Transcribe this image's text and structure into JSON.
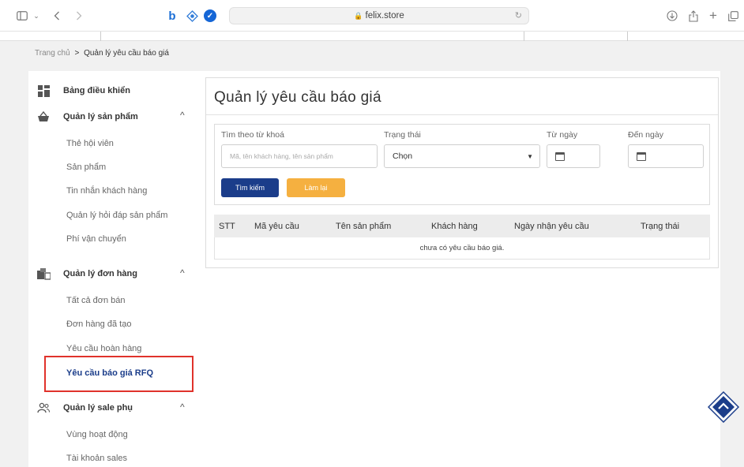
{
  "browser": {
    "url": "felix.store"
  },
  "breadcrumb": {
    "home": "Trang chủ",
    "separator": ">",
    "current": "Quản lý yêu cầu báo giá"
  },
  "sidebar": {
    "dashboard": "Bảng điều khiển",
    "products": {
      "label": "Quản lý sản phẩm",
      "items": [
        "Thẻ hội viên",
        "Sản phẩm",
        "Tin nhắn khách hàng",
        "Quản lý hỏi đáp sản phẩm",
        "Phí vận chuyển"
      ]
    },
    "orders": {
      "label": "Quản lý đơn hàng",
      "items": [
        "Tất cả đơn bán",
        "Đơn hàng đã tạo",
        "Yêu cầu hoàn hàng",
        "Yêu cầu báo giá RFQ"
      ]
    },
    "sales": {
      "label": "Quản lý sale phụ",
      "items": [
        "Vùng hoạt động",
        "Tài khoản sales"
      ]
    }
  },
  "main": {
    "title": "Quản lý yêu cầu báo giá",
    "filters": {
      "keyword_label": "Tìm theo từ khoá",
      "keyword_placeholder": "Mã, tên khách hàng, tên sản phẩm",
      "status_label": "Trạng thái",
      "status_value": "Chọn",
      "from_label": "Từ ngày",
      "to_label": "Đến ngày"
    },
    "buttons": {
      "search": "Tìm kiếm",
      "reset": "Làm lại"
    },
    "table": {
      "columns": [
        "STT",
        "Mã yêu cầu",
        "Tên sản phẩm",
        "Khách hàng",
        "Ngày nhận yêu cầu",
        "Trạng thái"
      ],
      "empty": "chưa có yêu cầu báo giá."
    }
  },
  "colors": {
    "primary": "#1b3d8a",
    "reset": "#f5b040",
    "highlight": "#e0322b"
  },
  "icons": [
    "sidebar-toggle-icon",
    "back-icon",
    "forward-icon",
    "lock-icon",
    "reload-icon",
    "download-icon",
    "share-icon",
    "new-tab-icon",
    "tabs-icon",
    "dashboard-icon",
    "basket-icon",
    "boxes-icon",
    "users-icon",
    "calendar-icon",
    "scroll-top-icon"
  ]
}
